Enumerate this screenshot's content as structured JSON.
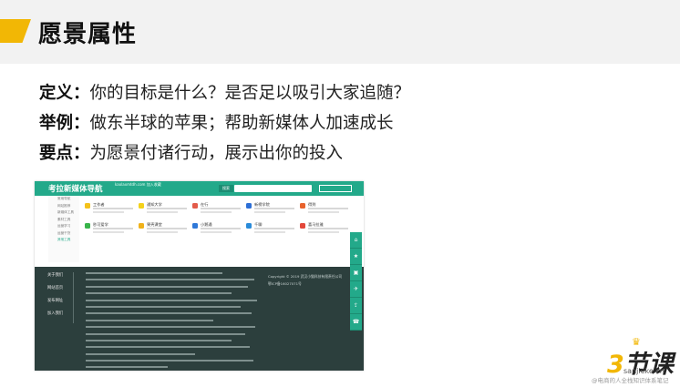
{
  "slide": {
    "title": "愿景属性"
  },
  "bullets": [
    {
      "key": "定义：",
      "text": "你的目标是什么？是否足以吸引大家追随？"
    },
    {
      "key": "举例：",
      "text": "做东半球的苹果；帮助新媒体人加速成长"
    },
    {
      "key": "要点：",
      "text": "为愿景付诸行动，展示出你的投入"
    }
  ],
  "embedded_site": {
    "logo": "考拉新媒体导航",
    "subtitle": "kaolaxmtdh.com   加入收藏",
    "search_button": "搜索",
    "sidebar": [
      "常用导航",
      "网站推荐",
      "新媒体工具",
      "素材工具",
      "运营学习",
      "运营干货",
      "其他工具"
    ],
    "cards": [
      {
        "name": "工作者"
      },
      {
        "name": "通知大学"
      },
      {
        "name": "在行"
      },
      {
        "name": "新榜学院"
      },
      {
        "name": "得到"
      },
      {
        "name": "秒可爱学"
      },
      {
        "name": "果壳课堂"
      },
      {
        "name": "小鹅通"
      },
      {
        "name": "千聊"
      },
      {
        "name": "喜马拉雅"
      }
    ],
    "footer_links": [
      "关于我们",
      "网站首页",
      "发布网址",
      "加入我们"
    ],
    "footer_right": [
      "Copyright © 2019 武汉小猫科技有限责任公司",
      "鄂ICP备16027071号"
    ],
    "rail": [
      "⌂",
      "★",
      "▣",
      "✈",
      "⇪",
      "☎"
    ]
  },
  "brand": {
    "logo_num": "3",
    "logo_text": "节课",
    "sub": "sanjieke.cn"
  },
  "watermark": "@电商的人全栈知识体系笔记",
  "colors": {
    "accent": "#f2b705",
    "site_green": "#23a98a",
    "footer": "#2c3f3d"
  }
}
